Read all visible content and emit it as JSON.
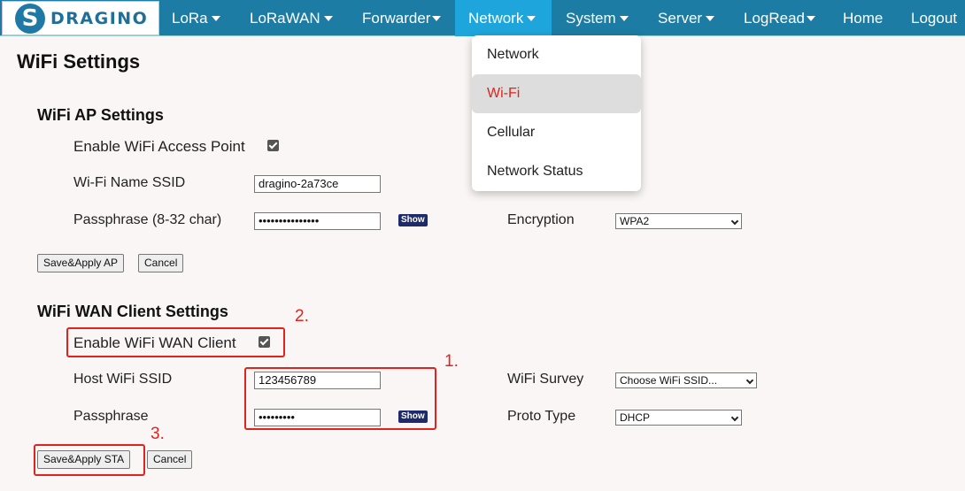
{
  "brand": {
    "name": "DRAGINO"
  },
  "nav": [
    {
      "label": "LoRa",
      "caret": true
    },
    {
      "label": "LoRaWAN",
      "caret": true
    },
    {
      "label": "Forwarder",
      "caret": true
    },
    {
      "label": "Network",
      "caret": true,
      "active": true
    },
    {
      "label": "System",
      "caret": true
    },
    {
      "label": "Server",
      "caret": true
    },
    {
      "label": "LogRead",
      "caret": true
    },
    {
      "label": "Home",
      "caret": false
    },
    {
      "label": "Logout",
      "caret": false
    }
  ],
  "page_title": "WiFi Settings",
  "ap": {
    "title": "WiFi AP Settings",
    "enable_label": "Enable WiFi Access Point",
    "enable_checked": true,
    "ssid_label": "Wi-Fi Name SSID",
    "ssid_value": "dragino-2a73ce",
    "pass_label": "Passphrase (8-32 char)",
    "pass_value": "•••••••••••••••",
    "show_label": "Show",
    "enc_label": "Encryption",
    "enc_value": "WPA2",
    "save_label": "Save&Apply AP",
    "cancel_label": "Cancel"
  },
  "wan": {
    "title": "WiFi WAN Client Settings",
    "enable_label": "Enable WiFi WAN Client",
    "enable_checked": true,
    "ssid_label": "Host WiFi SSID",
    "ssid_value": "123456789",
    "pass_label": "Passphrase",
    "pass_value": "•••••••••",
    "show_label": "Show",
    "survey_label": "WiFi Survey",
    "survey_value": "Choose WiFi SSID...",
    "proto_label": "Proto Type",
    "proto_value": "DHCP",
    "save_label": "Save&Apply STA",
    "cancel_label": "Cancel"
  },
  "network_menu": {
    "items": [
      "Network",
      "Wi-Fi",
      "Cellular",
      "Network Status"
    ],
    "selected": "Wi-Fi"
  },
  "annotations": [
    "1.",
    "2.",
    "3."
  ],
  "colors": {
    "nav_bg": "#1d7ca3",
    "nav_active": "#1ea6dc",
    "annotation": "#e0231d",
    "selected_menu_text": "#e0231d"
  }
}
